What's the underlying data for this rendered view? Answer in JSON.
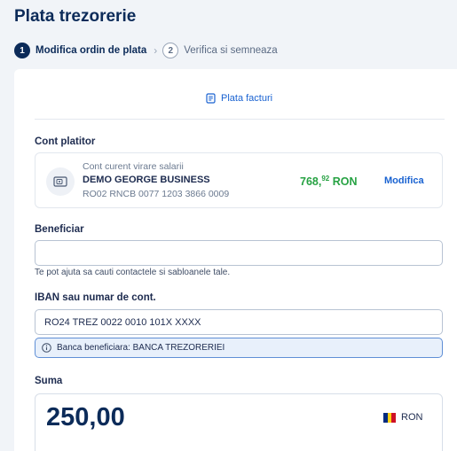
{
  "page": {
    "title": "Plata trezorerie"
  },
  "stepper": {
    "steps": [
      {
        "number": "1",
        "label": "Modifica ordin de plata"
      },
      {
        "number": "2",
        "label": "Verifica si semneaza"
      }
    ],
    "separator": "›"
  },
  "invoice_link": {
    "label": "Plata facturi",
    "icon": "document-icon"
  },
  "payer": {
    "section_label": "Cont platitor",
    "account_type": "Cont curent virare salarii",
    "account_name": "DEMO GEORGE BUSINESS",
    "iban": "RO02 RNCB 0077 1203 3866 0009",
    "balance_main": "768,",
    "balance_decimals": "92",
    "balance_currency": "RON",
    "modify_label": "Modifica",
    "icon": "wallet-icon"
  },
  "beneficiary": {
    "section_label": "Beneficiar",
    "value": "",
    "hint": "Te pot ajuta sa cauti contactele si sabloanele tale."
  },
  "iban_field": {
    "section_label": "IBAN sau numar de cont.",
    "value": "RO24 TREZ 0022 0010 101X XXXX",
    "info": "Banca beneficiara: BANCA TREZORERIEI",
    "info_icon": "info-icon"
  },
  "amount": {
    "section_label": "Suma",
    "value": "250,00",
    "currency": "RON",
    "flag_colors": [
      "#002b7f",
      "#fcd116",
      "#ce1126"
    ]
  },
  "colors": {
    "accent": "#1962d1",
    "title": "#0c2b59",
    "balance_positive": "#27a243",
    "background": "#f1f4f8"
  }
}
